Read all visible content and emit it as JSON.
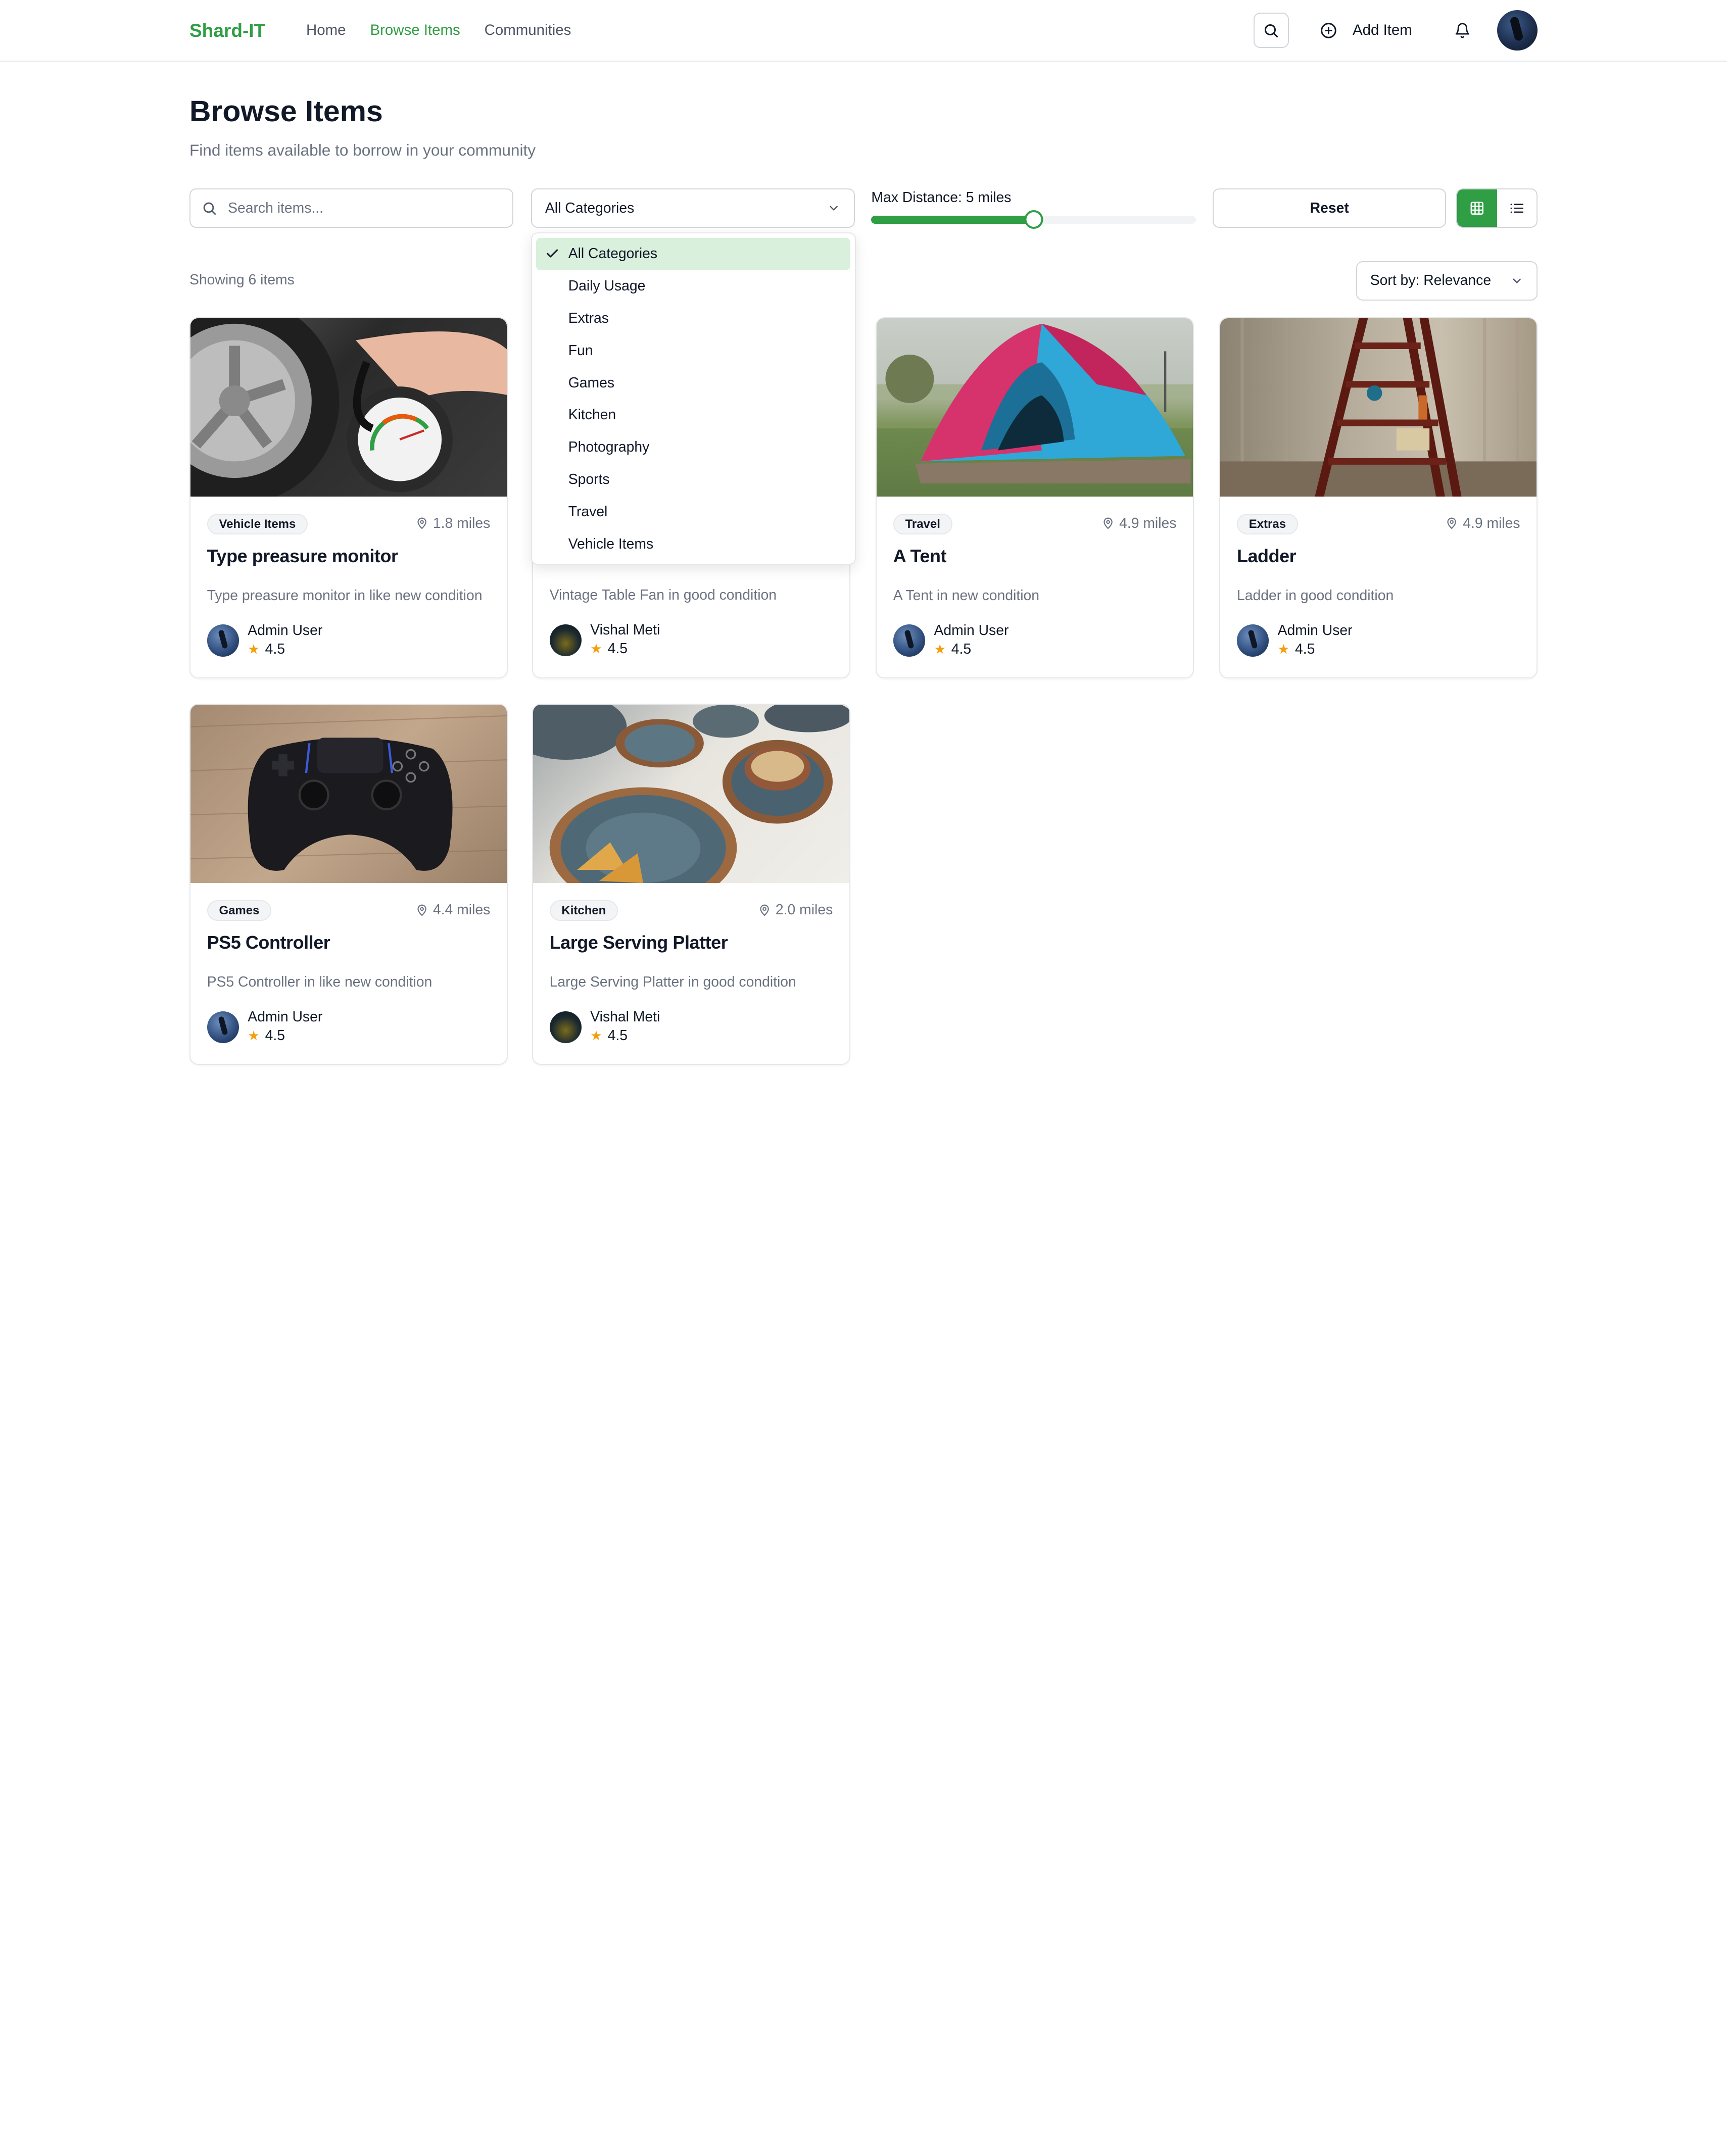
{
  "app": {
    "logo": "Shard-IT"
  },
  "nav": {
    "links": [
      {
        "label": "Home",
        "active": false
      },
      {
        "label": "Browse Items",
        "active": true
      },
      {
        "label": "Communities",
        "active": false
      }
    ],
    "add_item_label": "Add Item"
  },
  "header": {
    "title": "Browse Items",
    "subtitle": "Find items available to borrow in your community"
  },
  "filters": {
    "search_placeholder": "Search items...",
    "category_selected": "All Categories",
    "distance_label": "Max Distance: 5 miles",
    "distance_fraction": 0.5,
    "reset_label": "Reset",
    "view_mode": "grid"
  },
  "results": {
    "showing": "Showing 6 items",
    "sort_label": "Sort by: Relevance"
  },
  "dropdown": {
    "options": [
      {
        "label": "All Categories",
        "selected": true
      },
      {
        "label": "Daily Usage",
        "selected": false
      },
      {
        "label": "Extras",
        "selected": false
      },
      {
        "label": "Fun",
        "selected": false
      },
      {
        "label": "Games",
        "selected": false
      },
      {
        "label": "Kitchen",
        "selected": false
      },
      {
        "label": "Photography",
        "selected": false
      },
      {
        "label": "Sports",
        "selected": false
      },
      {
        "label": "Travel",
        "selected": false
      },
      {
        "label": "Vehicle Items",
        "selected": false
      }
    ]
  },
  "items": [
    {
      "category": "Vehicle Items",
      "distance": "1.8 miles",
      "title": "Type preasure monitor",
      "description": "Type preasure monitor in like new condition",
      "owner": "Admin User",
      "rating": "4.5",
      "image": "tire-gauge"
    },
    {
      "category": "",
      "distance": "",
      "title": "",
      "description": "Vintage Table Fan in good condition",
      "owner": "Vishal Meti",
      "rating": "4.5",
      "image": "table-fan"
    },
    {
      "category": "Travel",
      "distance": "4.9 miles",
      "title": "A Tent",
      "description": "A Tent in new condition",
      "owner": "Admin User",
      "rating": "4.5",
      "image": "tent"
    },
    {
      "category": "Extras",
      "distance": "4.9 miles",
      "title": "Ladder",
      "description": "Ladder in good condition",
      "owner": "Admin User",
      "rating": "4.5",
      "image": "ladder"
    },
    {
      "category": "Games",
      "distance": "4.4 miles",
      "title": "PS5 Controller",
      "description": "PS5 Controller in like new condition",
      "owner": "Admin User",
      "rating": "4.5",
      "image": "ps5-controller"
    },
    {
      "category": "Kitchen",
      "distance": "2.0 miles",
      "title": "Large Serving Platter",
      "description": "Large Serving Platter in good condition",
      "owner": "Vishal Meti",
      "rating": "4.5",
      "image": "serving-platter"
    }
  ],
  "colors": {
    "accent": "#2f9e44",
    "selected_bg": "#d8f0dc",
    "star": "#f59e0b",
    "muted_text": "#6b7280"
  }
}
